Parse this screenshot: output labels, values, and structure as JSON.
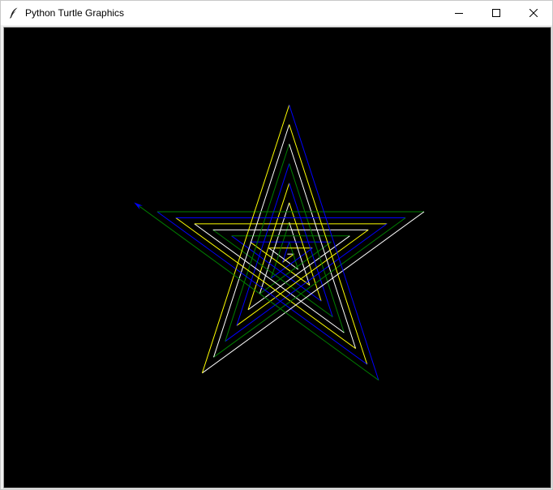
{
  "window": {
    "title": "Python Turtle Graphics",
    "icon": "feather-icon",
    "controls": {
      "minimize_icon": "minimize-icon",
      "maximize_icon": "maximize-icon",
      "close_icon": "close-icon"
    }
  },
  "canvas": {
    "background": "#000000",
    "pen_colors": [
      "#ffffff",
      "#ffff00",
      "#0000ff",
      "#008000"
    ],
    "turtle_color": "#0000ff",
    "shape": "five-pointed-star"
  }
}
